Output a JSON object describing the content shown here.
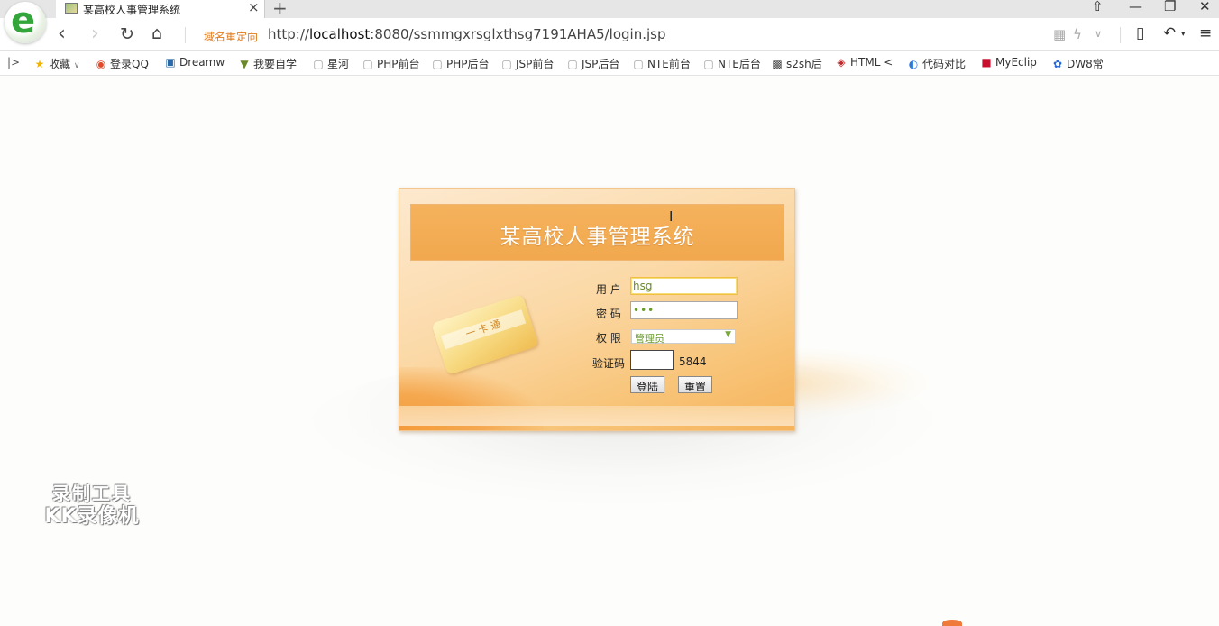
{
  "browser": {
    "tab_title": "某高校人事管理系统",
    "tab_close": "×",
    "new_tab": "+",
    "redirect_label": "域名重定向",
    "url_prefix": "http://",
    "url_host": "localhost",
    "url_rest": ":8080/ssmmgxrsglxthsg7191AHA5/login.jsp",
    "logo_letter": "e"
  },
  "bookmarks": [
    {
      "label": "收藏",
      "icon": "star-icon"
    },
    {
      "label": "登录QQ",
      "icon": "browser-icon"
    },
    {
      "label": "Dreamw",
      "icon": "dreamweaver-icon"
    },
    {
      "label": "我要自学",
      "icon": "book-icon"
    },
    {
      "label": "星河",
      "icon": "page-icon"
    },
    {
      "label": "PHP前台",
      "icon": "page-icon"
    },
    {
      "label": "PHP后台",
      "icon": "page-icon"
    },
    {
      "label": "JSP前台",
      "icon": "page-icon"
    },
    {
      "label": "JSP后台",
      "icon": "page-icon"
    },
    {
      "label": "NTE前台",
      "icon": "page-icon"
    },
    {
      "label": "NTE后台",
      "icon": "page-icon"
    },
    {
      "label": "s2sh后",
      "icon": "image-icon"
    },
    {
      "label": "HTML <",
      "icon": "html-icon"
    },
    {
      "label": "代码对比",
      "icon": "compare-icon"
    },
    {
      "label": "MyEclip",
      "icon": "myeclipse-icon"
    },
    {
      "label": "DW8常",
      "icon": "paw-icon"
    }
  ],
  "login": {
    "title": "某高校人事管理系统",
    "card_text": "一 卡 通",
    "username_label": "用 户",
    "username_value": "hsg",
    "password_label": "密 码",
    "password_value": "•••",
    "role_label": "权 限",
    "role_selected": "管理员",
    "captcha_label": "验证码",
    "captcha_value": "",
    "captcha_code": "5844",
    "login_button": "登陆",
    "reset_button": "重置"
  },
  "watermark": {
    "line1": "录制工具",
    "line2": "KK录像机"
  },
  "colors": {
    "accent": "#f1a84e",
    "redirect": "#e07b1e",
    "brand_green": "#33a53b"
  }
}
